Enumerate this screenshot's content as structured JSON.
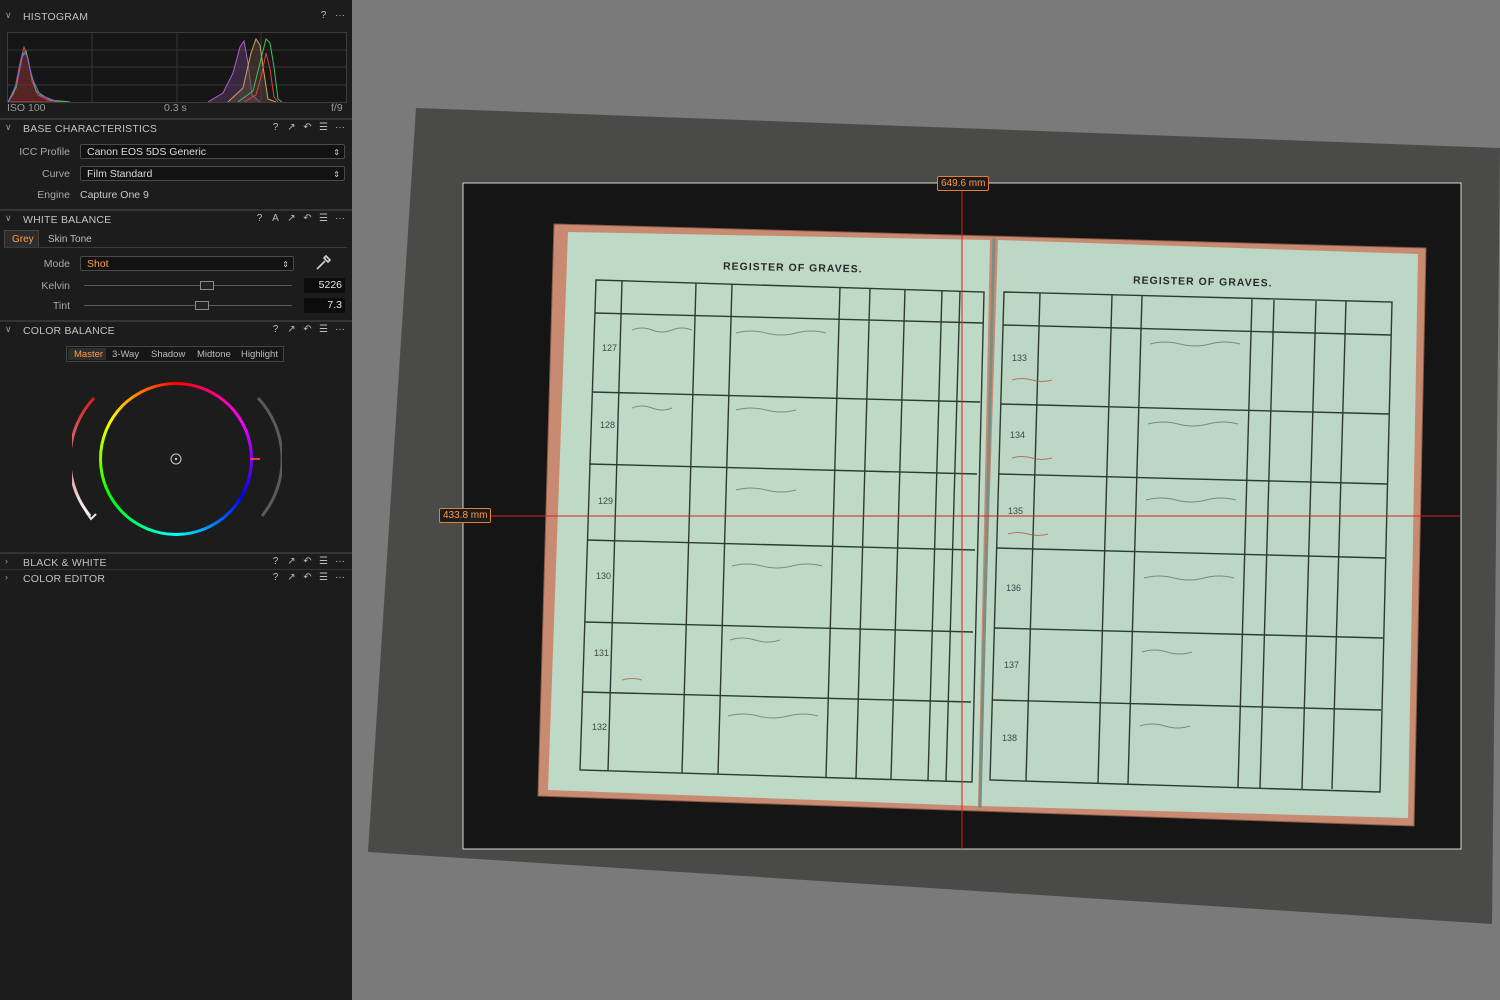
{
  "histogram": {
    "title": "HISTOGRAM",
    "help": "?",
    "more": "···",
    "iso": "ISO 100",
    "shutter": "0.3 s",
    "aperture": "f/9"
  },
  "base_characteristics": {
    "title": "BASE CHARACTERISTICS",
    "icc_label": "ICC Profile",
    "icc_value": "Canon EOS 5DS Generic",
    "curve_label": "Curve",
    "curve_value": "Film Standard",
    "engine_label": "Engine",
    "engine_value": "Capture One 9"
  },
  "white_balance": {
    "title": "WHITE BALANCE",
    "tab_grey": "Grey",
    "tab_skin": "Skin Tone",
    "mode_label": "Mode",
    "mode_value": "Shot",
    "kelvin_label": "Kelvin",
    "kelvin_value": "5226",
    "tint_label": "Tint",
    "tint_value": "7.3"
  },
  "color_balance": {
    "title": "COLOR BALANCE",
    "tabs": [
      "Master",
      "3-Way",
      "Shadow",
      "Midtone",
      "Highlight"
    ]
  },
  "collapsed_sections": {
    "bw": "BLACK & WHITE",
    "color_editor": "COLOR EDITOR"
  },
  "viewer": {
    "width_measure": "649.6 mm",
    "height_measure": "433.8 mm",
    "left_page_title": "REGISTER OF GRAVES.",
    "right_page_title": "REGISTER OF GRAVES.",
    "left_row_numbers": [
      "127",
      "128",
      "129",
      "130",
      "131",
      "132"
    ],
    "right_row_numbers": [
      "133",
      "134",
      "135",
      "136",
      "137",
      "138"
    ]
  },
  "colors": {
    "accent_orange": "#ff9c4a",
    "crosshair_red": "#d8201e",
    "page_green": "#bfd9c7",
    "panel_bg": "#1c1c1c"
  }
}
